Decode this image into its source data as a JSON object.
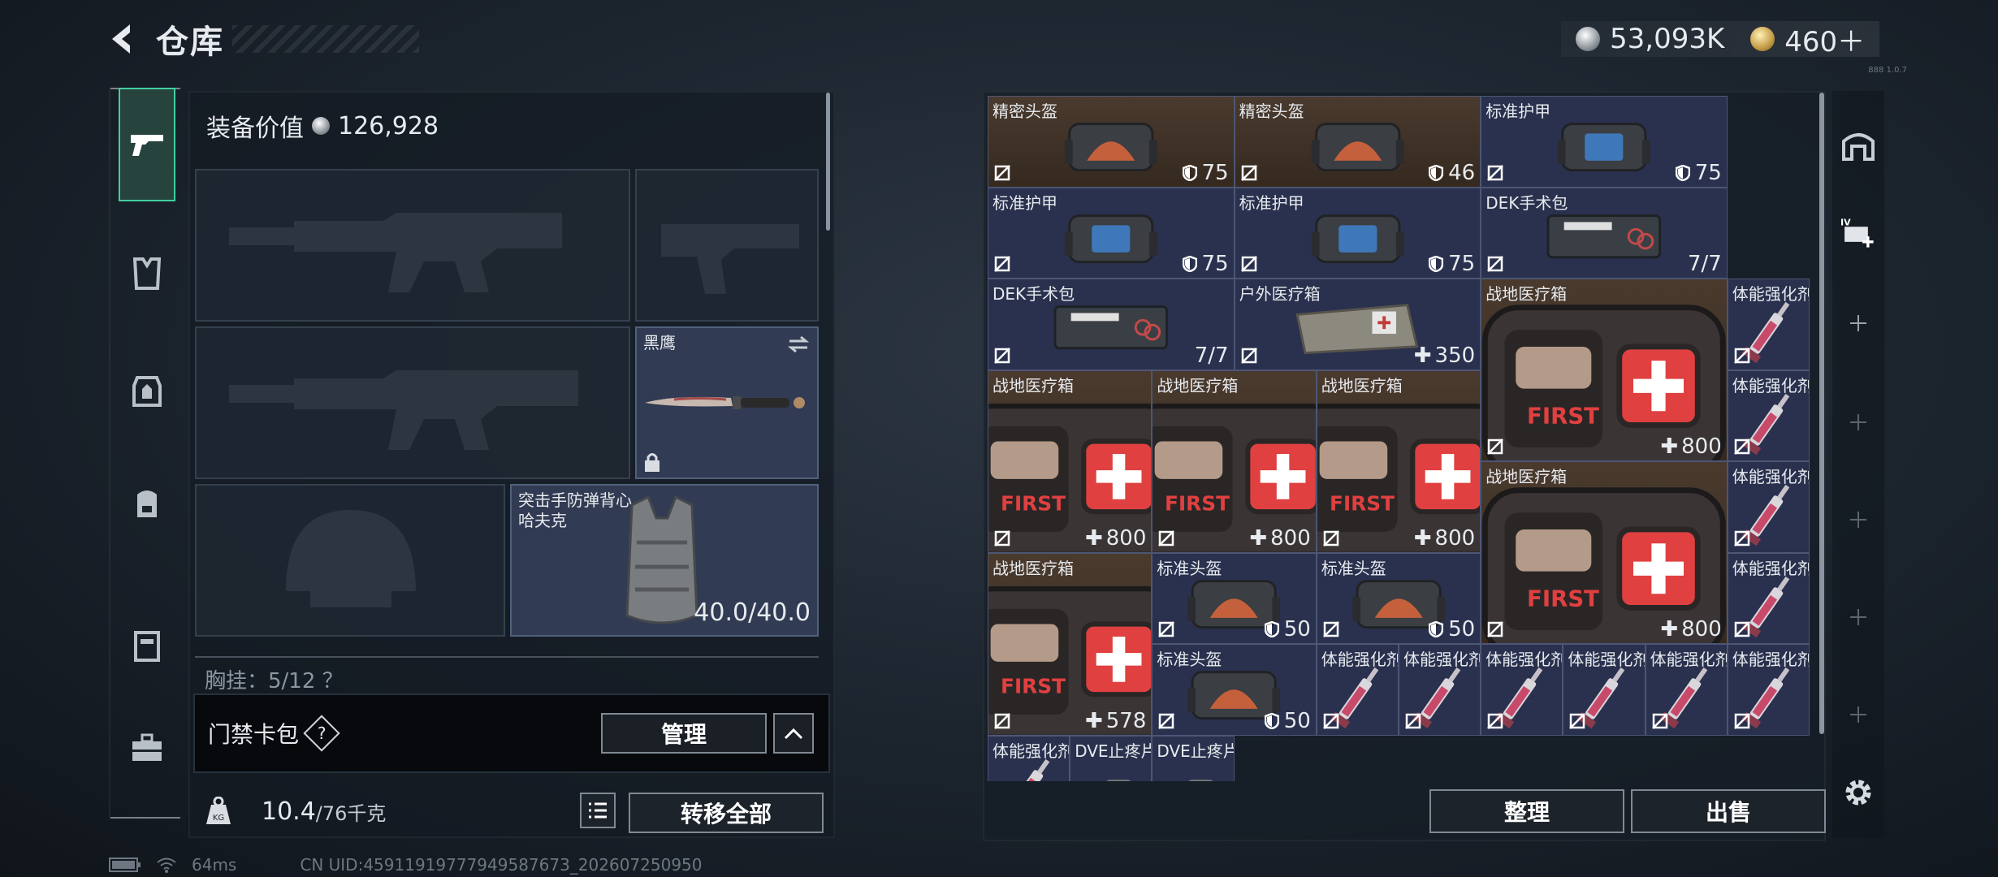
{
  "header": {
    "title": "仓库"
  },
  "currency": {
    "silver": "53,093K",
    "gold": "460＋"
  },
  "version": "888 1.0.7",
  "sidebar": [
    "pistol-icon",
    "vest-icon",
    "armor-icon",
    "backpack-icon",
    "pouch-icon",
    "briefcase-icon"
  ],
  "equipment": {
    "value_label": "装备价值",
    "value": "126,928",
    "melee": {
      "name": "黑鹰"
    },
    "armor": {
      "name": "突击手防弹背心\n哈夫克",
      "durability": "40.0/40.0"
    },
    "chest_rig_text": "胸挂：5/12 ？"
  },
  "keycard": {
    "label": "门禁卡包",
    "help": "?",
    "manage": "管理"
  },
  "weight": {
    "current": "10.4",
    "max": "/76千克",
    "transfer": "转移全部"
  },
  "inventory": {
    "items": [
      {
        "name": "精密头盔",
        "value": "75",
        "kind": "helmet",
        "bg": "brown",
        "icon": "shield"
      },
      {
        "name": "精密头盔",
        "value": "46",
        "kind": "helmet",
        "bg": "brown",
        "icon": "shield"
      },
      {
        "name": "标准护甲",
        "value": "75",
        "kind": "armor",
        "bg": "blue",
        "icon": "shield"
      },
      {
        "name": "标准护甲",
        "value": "75",
        "kind": "armor",
        "bg": "blue",
        "icon": "shield"
      },
      {
        "name": "标准护甲",
        "value": "75",
        "kind": "armor",
        "bg": "blue",
        "icon": "shield"
      },
      {
        "name": "DEK手术包",
        "value": "7/7",
        "kind": "surgery",
        "bg": "blue",
        "icon": "none"
      },
      {
        "name": "DEK手术包",
        "value": "7/7",
        "kind": "surgery",
        "bg": "blue",
        "icon": "none"
      },
      {
        "name": "户外医疗箱",
        "value": "350",
        "kind": "outdoor",
        "bg": "blue",
        "icon": "plus"
      },
      {
        "name": "战地医疗箱",
        "value": "800",
        "kind": "medkit",
        "bg": "brown",
        "icon": "plus"
      },
      {
        "name": "体能强化剂",
        "value": "",
        "kind": "syringe",
        "bg": "blue",
        "icon": "none"
      },
      {
        "name": "体能强化剂",
        "value": "",
        "kind": "syringe",
        "bg": "blue",
        "icon": "none"
      },
      {
        "name": "战地医疗箱",
        "value": "800",
        "kind": "medkit",
        "bg": "brown",
        "icon": "plus"
      },
      {
        "name": "战地医疗箱",
        "value": "800",
        "kind": "medkit",
        "bg": "brown",
        "icon": "plus"
      },
      {
        "name": "战地医疗箱",
        "value": "800",
        "kind": "medkit",
        "bg": "brown",
        "icon": "plus"
      },
      {
        "name": "战地医疗箱",
        "value": "800",
        "kind": "medkit",
        "bg": "brown",
        "icon": "plus"
      },
      {
        "name": "体能强化剂",
        "value": "",
        "kind": "syringe",
        "bg": "blue",
        "icon": "none"
      },
      {
        "name": "体能强化剂",
        "value": "",
        "kind": "syringe",
        "bg": "blue",
        "icon": "none"
      },
      {
        "name": "战地医疗箱",
        "value": "578",
        "kind": "medkit",
        "bg": "brown",
        "icon": "plus"
      },
      {
        "name": "标准头盔",
        "value": "50",
        "kind": "helmet",
        "bg": "blue",
        "icon": "shield"
      },
      {
        "name": "标准头盔",
        "value": "50",
        "kind": "helmet",
        "bg": "blue",
        "icon": "shield"
      },
      {
        "name": "标准头盔",
        "value": "50",
        "kind": "helmet",
        "bg": "blue",
        "icon": "shield"
      },
      {
        "name": "体能强化剂",
        "value": "",
        "kind": "syringe",
        "bg": "blue",
        "icon": "none"
      },
      {
        "name": "体能强化剂",
        "value": "",
        "kind": "syringe",
        "bg": "blue",
        "icon": "none"
      },
      {
        "name": "体能强化剂",
        "value": "",
        "kind": "syringe",
        "bg": "blue",
        "icon": "none"
      },
      {
        "name": "体能强化剂",
        "value": "",
        "kind": "syringe",
        "bg": "blue",
        "icon": "none"
      },
      {
        "name": "体能强化剂",
        "value": "",
        "kind": "syringe",
        "bg": "blue",
        "icon": "none"
      },
      {
        "name": "体能强化剂",
        "value": "",
        "kind": "syringe",
        "bg": "blue",
        "icon": "none"
      },
      {
        "name": "体能强化剂",
        "value": "",
        "kind": "syringe",
        "bg": "blue",
        "icon": "none"
      },
      {
        "name": "DVE止疼片",
        "value": "",
        "kind": "pill",
        "bg": "blue",
        "icon": "none"
      },
      {
        "name": "DVE止疼片",
        "value": "",
        "kind": "pill",
        "bg": "blue",
        "icon": "none"
      }
    ],
    "sort_button": "整理",
    "sell_button": "出售"
  },
  "footer": {
    "ping": "64ms",
    "uid": "CN UID:4591191977794958767​3_202607250950"
  }
}
